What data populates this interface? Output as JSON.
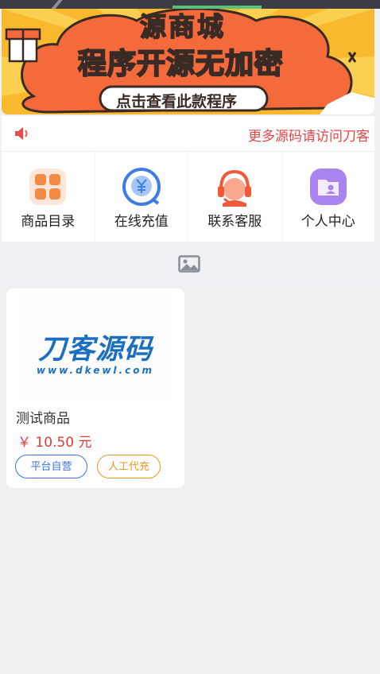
{
  "banner": {
    "title_line1": "源商城",
    "title_line2": "程序开源无加密",
    "button_label": "点击查看此款程序"
  },
  "notice": {
    "icon": "speaker-icon",
    "text": "更多源码请访问刀客"
  },
  "menu": [
    {
      "label": "商品目录",
      "icon": "grid-icon"
    },
    {
      "label": "在线充值",
      "icon": "yuan-recharge-icon"
    },
    {
      "label": "联系客服",
      "icon": "headset-icon"
    },
    {
      "label": "个人中心",
      "icon": "user-folder-icon"
    }
  ],
  "colors": {
    "accent_red": "#e64545",
    "price_red": "#e53935",
    "tag_blue": "#3b74e0",
    "tag_orange": "#e69a1a",
    "logo_blue": "#1a6fc0"
  },
  "product": {
    "logo_text": "刀客源码",
    "logo_url": "www.dkewl.com",
    "name": "测试商品",
    "price": "￥ 10.50 元",
    "tags": [
      "平台自营",
      "人工代充"
    ]
  }
}
